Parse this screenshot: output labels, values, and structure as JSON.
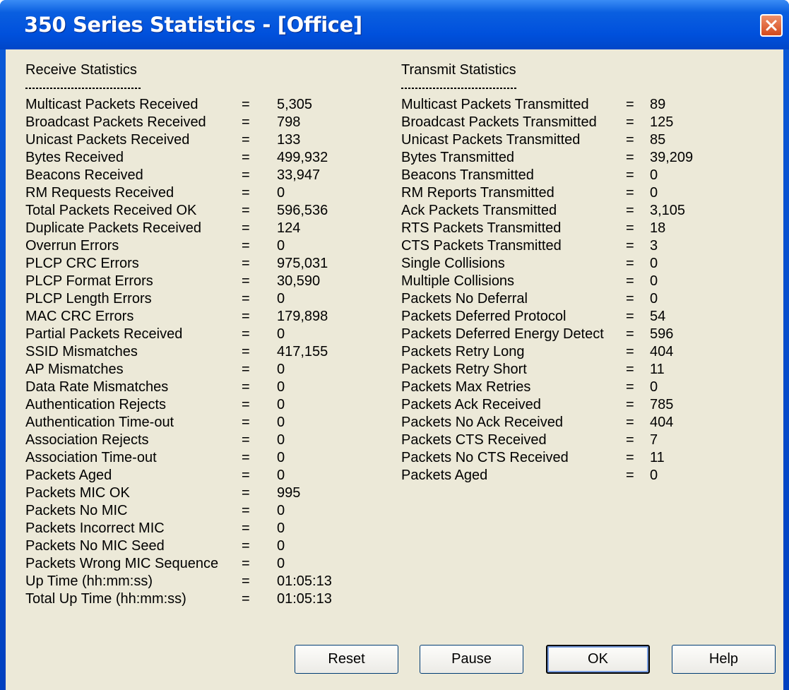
{
  "window": {
    "title": "350 Series Statistics - [Office]"
  },
  "receive": {
    "header": "Receive Statistics",
    "rows": [
      {
        "label": "Multicast Packets Received",
        "value": "5,305"
      },
      {
        "label": "Broadcast Packets Received",
        "value": "798"
      },
      {
        "label": "Unicast Packets Received",
        "value": "133"
      },
      {
        "label": "Bytes Received",
        "value": "499,932"
      },
      {
        "label": "Beacons Received",
        "value": "33,947"
      },
      {
        "label": "RM Requests Received",
        "value": "0"
      },
      {
        "label": "Total Packets Received OK",
        "value": "596,536"
      },
      {
        "label": "Duplicate Packets Received",
        "value": "124"
      },
      {
        "label": "Overrun Errors",
        "value": "0"
      },
      {
        "label": "PLCP CRC Errors",
        "value": "975,031"
      },
      {
        "label": "PLCP Format Errors",
        "value": "30,590"
      },
      {
        "label": "PLCP Length Errors",
        "value": "0"
      },
      {
        "label": "MAC CRC Errors",
        "value": "179,898"
      },
      {
        "label": "Partial Packets Received",
        "value": "0"
      },
      {
        "label": "SSID Mismatches",
        "value": "417,155"
      },
      {
        "label": "AP Mismatches",
        "value": "0"
      },
      {
        "label": "Data Rate Mismatches",
        "value": "0"
      },
      {
        "label": "Authentication Rejects",
        "value": "0"
      },
      {
        "label": "Authentication Time-out",
        "value": "0"
      },
      {
        "label": "Association Rejects",
        "value": "0"
      },
      {
        "label": "Association Time-out",
        "value": "0"
      },
      {
        "label": "Packets Aged",
        "value": "0"
      },
      {
        "label": "Packets MIC OK",
        "value": "995"
      },
      {
        "label": "Packets No MIC",
        "value": "0"
      },
      {
        "label": "Packets Incorrect MIC",
        "value": "0"
      },
      {
        "label": "Packets No MIC Seed",
        "value": "0"
      },
      {
        "label": "Packets Wrong MIC Sequence",
        "value": "0"
      },
      {
        "label": "Up Time (hh:mm:ss)",
        "value": "01:05:13"
      },
      {
        "label": "Total Up Time (hh:mm:ss)",
        "value": "01:05:13"
      }
    ]
  },
  "transmit": {
    "header": "Transmit Statistics",
    "rows": [
      {
        "label": "Multicast Packets Transmitted",
        "value": "89"
      },
      {
        "label": "Broadcast Packets Transmitted",
        "value": "125"
      },
      {
        "label": "Unicast Packets Transmitted",
        "value": "85"
      },
      {
        "label": "Bytes Transmitted",
        "value": "39,209"
      },
      {
        "label": "Beacons Transmitted",
        "value": "0"
      },
      {
        "label": "RM Reports Transmitted",
        "value": "0"
      },
      {
        "label": "Ack Packets Transmitted",
        "value": "3,105"
      },
      {
        "label": "RTS Packets Transmitted",
        "value": "18"
      },
      {
        "label": "CTS Packets Transmitted",
        "value": "3"
      },
      {
        "label": "Single Collisions",
        "value": "0"
      },
      {
        "label": "Multiple Collisions",
        "value": "0"
      },
      {
        "label": "Packets No Deferral",
        "value": "0"
      },
      {
        "label": "Packets Deferred Protocol",
        "value": "54"
      },
      {
        "label": "Packets Deferred Energy Detect",
        "value": "596"
      },
      {
        "label": "Packets Retry Long",
        "value": "404"
      },
      {
        "label": "Packets Retry Short",
        "value": "11"
      },
      {
        "label": "Packets Max Retries",
        "value": "0"
      },
      {
        "label": "Packets Ack Received",
        "value": "785"
      },
      {
        "label": "Packets No Ack Received",
        "value": "404"
      },
      {
        "label": "Packets CTS Received",
        "value": "7"
      },
      {
        "label": "Packets No CTS Received",
        "value": "11"
      },
      {
        "label": "Packets Aged",
        "value": "0"
      }
    ]
  },
  "equals": "=",
  "buttons": {
    "reset": "Reset",
    "pause": "Pause",
    "ok": "OK",
    "help": "Help"
  }
}
